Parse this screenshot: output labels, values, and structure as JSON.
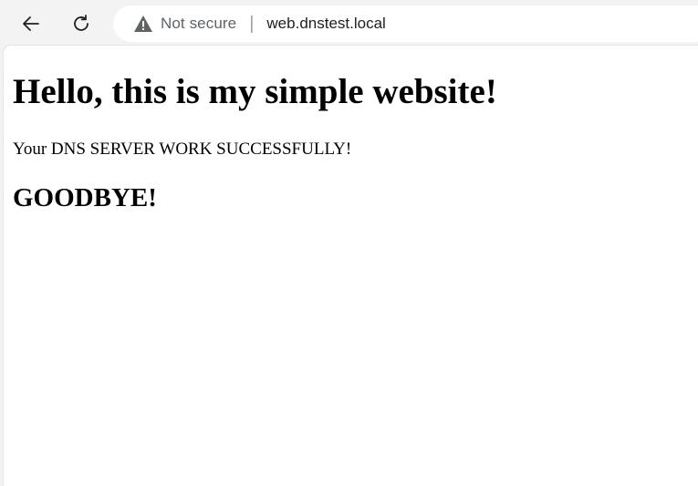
{
  "browser": {
    "icons": {
      "back": "arrow-left-icon",
      "reload": "reload-icon",
      "security": "warning-triangle-icon"
    },
    "address_bar": {
      "security_label": "Not secure",
      "url": "web.dnstest.local"
    }
  },
  "page": {
    "heading": "Hello, this is my simple website!",
    "paragraph": "Your DNS SERVER WORK SUCCESSFULLY!",
    "subheading": "GOODBYE!"
  }
}
